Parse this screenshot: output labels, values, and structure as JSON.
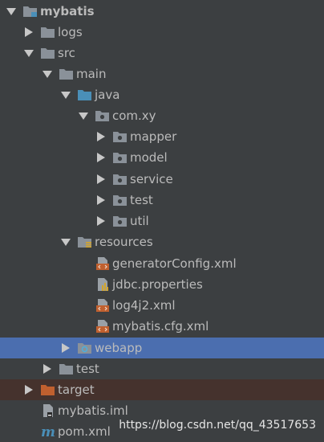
{
  "tree": {
    "project": "mybatis",
    "logs": "logs",
    "src": "src",
    "main": "main",
    "java": "java",
    "package": "com.xy",
    "mapper": "mapper",
    "model": "model",
    "service": "service",
    "test_pkg": "test",
    "util": "util",
    "resources": "resources",
    "generator": "generatorConfig.xml",
    "jdbc": "jdbc.properties",
    "log4j2": "log4j2.xml",
    "mybatis_cfg": "mybatis.cfg.xml",
    "webapp": "webapp",
    "test": "test",
    "target": "target",
    "iml": "mybatis.iml",
    "pom": "pom.xml"
  },
  "watermark": "https://blog.csdn.net/qq_43517653",
  "colors": {
    "background": "#3c3f41",
    "selection": "#4b6eaf",
    "excluded": "#45322d",
    "folder": "#8a9199",
    "source_folder": "#4a8fb8",
    "target_folder": "#c0602f",
    "xml_file": "#c0602f"
  },
  "icons": {
    "expanded": "chevron-down-icon",
    "collapsed": "chevron-right-icon",
    "folder": "folder-icon",
    "package": "package-icon",
    "xml": "xml-file-icon",
    "properties": "properties-file-icon"
  }
}
